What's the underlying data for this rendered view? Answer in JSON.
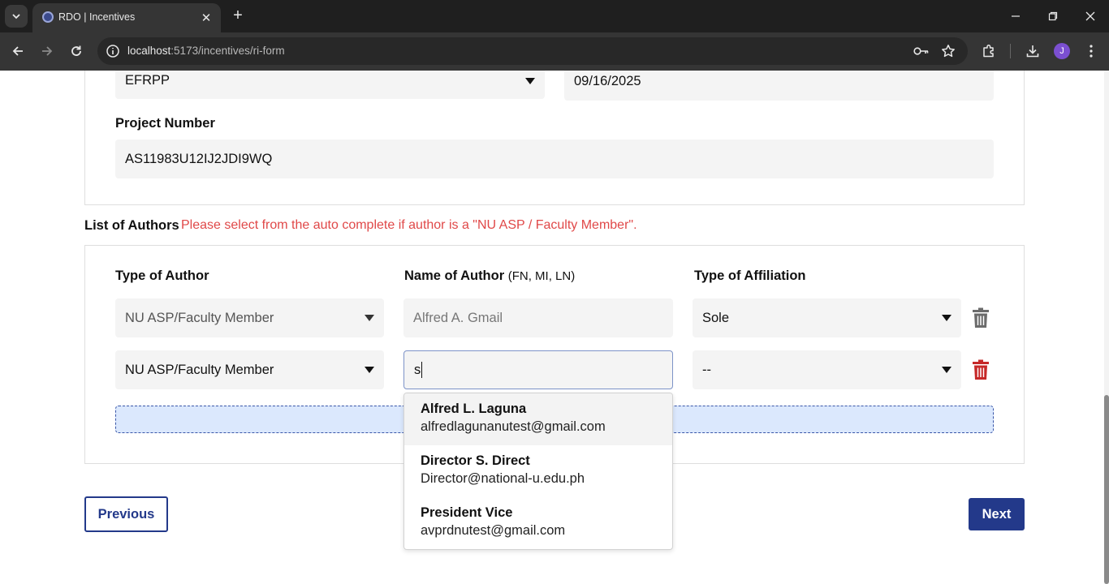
{
  "browser": {
    "tab_title": "RDO | Incentives",
    "url_host": "localhost",
    "url_rest": ":5173/incentives/ri-form",
    "avatar_letter": "J"
  },
  "form": {
    "program_value": "EFRPP",
    "date_value": "09/16/2025",
    "project_number_label": "Project Number",
    "project_number_value": "AS11983U12IJ2JDI9WQ"
  },
  "authors": {
    "title": "List of Authors",
    "note": "Please select from the auto complete if author is a \"NU ASP / Faculty Member\".",
    "col_type": "Type of Author",
    "col_name": "Name of Author",
    "col_name_sub": "(FN, MI, LN)",
    "col_affiliation": "Type of Affiliation",
    "rows": [
      {
        "type": "NU ASP/Faculty Member",
        "name": "Alfred A. Gmail",
        "affiliation": "Sole"
      },
      {
        "type": "NU ASP/Faculty Member",
        "name": "s",
        "affiliation": "--"
      }
    ],
    "suggestions": [
      {
        "name": "Alfred L. Laguna",
        "email": "alfredlagunanutest@gmail.com"
      },
      {
        "name": "Director S. Direct",
        "email": "Director@national-u.edu.ph"
      },
      {
        "name": "President Vice",
        "email": "avprdnutest@gmail.com"
      }
    ]
  },
  "nav": {
    "previous_label": "Previous",
    "next_label": "Next"
  },
  "colors": {
    "primary": "#23398a",
    "note_red": "#e04848",
    "delete_red": "#c62828",
    "delete_gray": "#6b6b6b",
    "add_bar": "#dbe8fd"
  }
}
